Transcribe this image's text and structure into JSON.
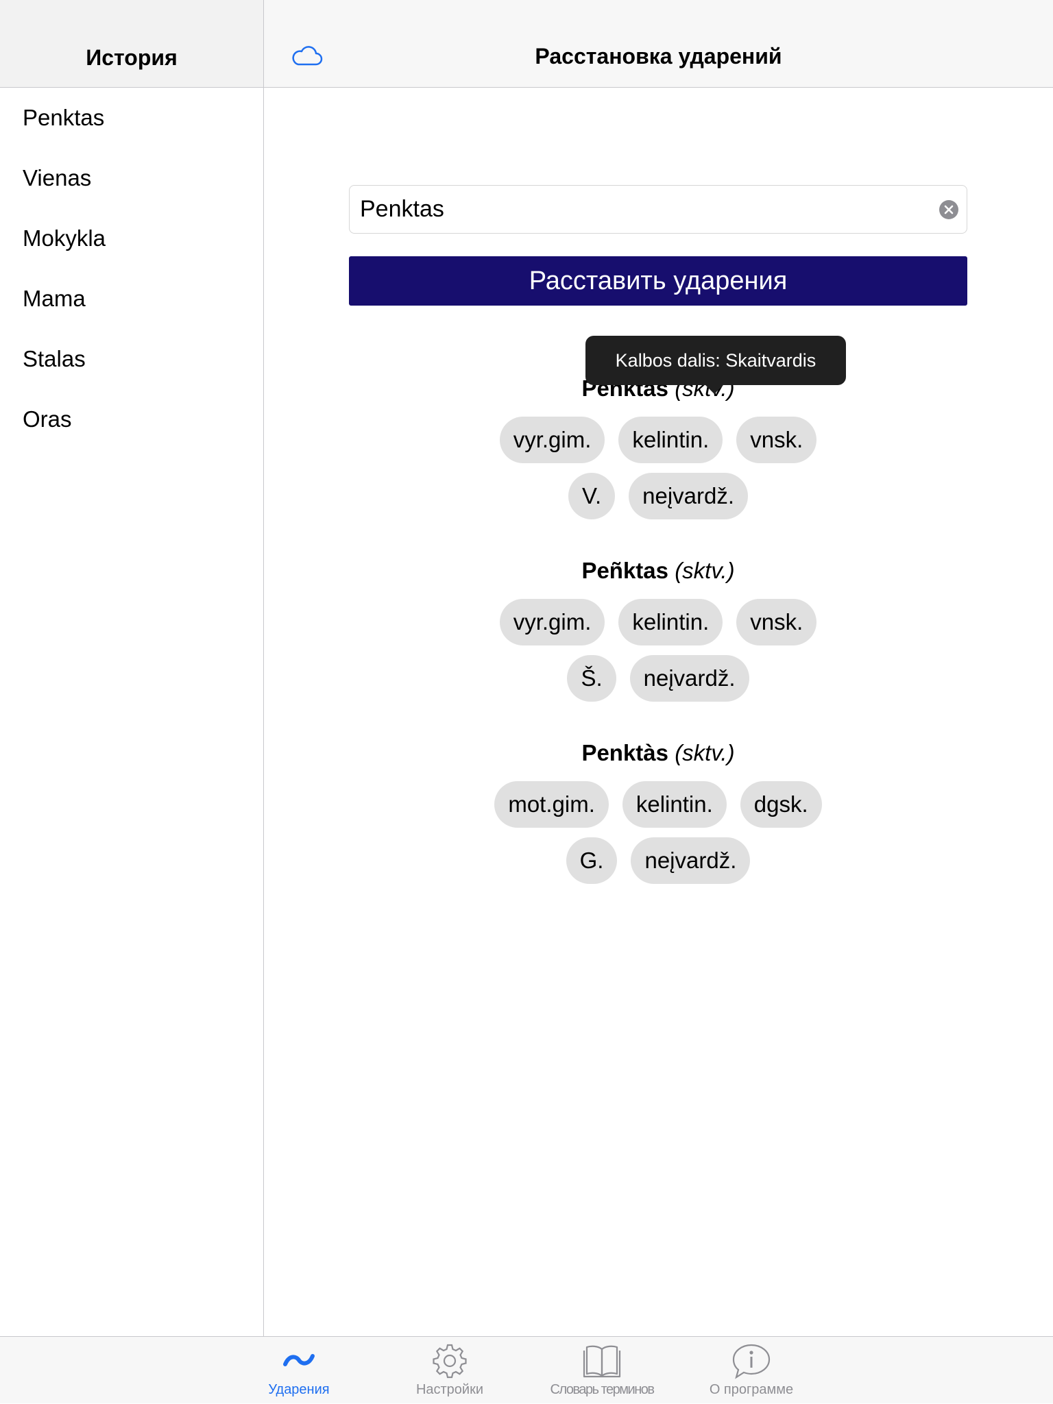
{
  "sidebar": {
    "title": "История",
    "items": [
      {
        "label": "Penktas"
      },
      {
        "label": "Vienas"
      },
      {
        "label": "Mokykla"
      },
      {
        "label": "Mama"
      },
      {
        "label": "Stalas"
      },
      {
        "label": "Oras"
      }
    ]
  },
  "header": {
    "title": "Расстановка ударений",
    "cloud_icon": "cloud-icon"
  },
  "search": {
    "value": "Penktas",
    "clear_icon": "clear-icon"
  },
  "submit": {
    "label": "Расставить ударения"
  },
  "tooltip": {
    "text": "Kalbos dalis: Skaitvardis"
  },
  "results": [
    {
      "word": "Peñktas",
      "pos": "(sktv.)",
      "rows": [
        [
          "vyr.gim.",
          "kelintin.",
          "vnsk."
        ],
        [
          "V.",
          "neįvardž."
        ]
      ]
    },
    {
      "word": "Peñktas",
      "pos": "(sktv.)",
      "rows": [
        [
          "vyr.gim.",
          "kelintin.",
          "vnsk."
        ],
        [
          "Š.",
          "neįvardž."
        ]
      ]
    },
    {
      "word": "Penktàs",
      "pos": "(sktv.)",
      "rows": [
        [
          "mot.gim.",
          "kelintin.",
          "dgsk."
        ],
        [
          "G.",
          "neįvardž."
        ]
      ]
    }
  ],
  "tabs": [
    {
      "label": "Ударения",
      "icon": "tilde-icon",
      "active": true
    },
    {
      "label": "Настройки",
      "icon": "gear-icon",
      "active": false
    },
    {
      "label": "Словарь терминов",
      "icon": "book-icon",
      "active": false
    },
    {
      "label": "О программе",
      "icon": "info-bubble-icon",
      "active": false
    }
  ],
  "colors": {
    "accent": "#1f6ff0",
    "button": "#170e6e",
    "chip": "#e0e0e0",
    "tooltip": "#202020"
  }
}
